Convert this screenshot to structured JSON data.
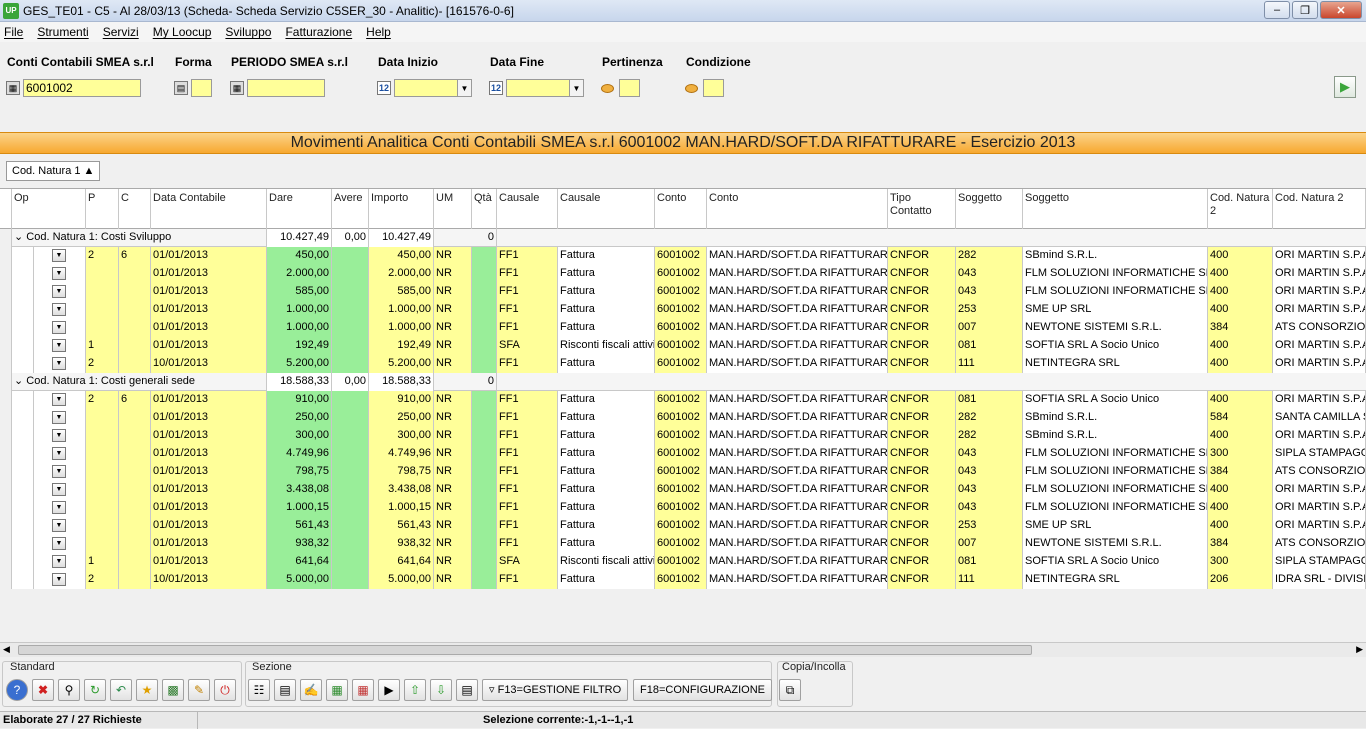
{
  "window": {
    "title": "GES_TE01 - C5 - Al 28/03/13 (Scheda- Scheda Servizio C5SER_30 - Analitic)- [161576-0-6]",
    "app_badge": "UP"
  },
  "menu": [
    "File",
    "Strumenti",
    "Servizi",
    "My Loocup",
    "Sviluppo",
    "Fatturazione",
    "Help"
  ],
  "filters": {
    "conti_label": "Conti Contabili SMEA s.r.l",
    "conti_value": "6001002",
    "forma_label": "Forma",
    "forma_value": "",
    "periodo_label": "PERIODO SMEA s.r.l",
    "periodo_value": "",
    "data_inizio_label": "Data Inizio",
    "data_inizio_value": "",
    "data_fine_label": "Data Fine",
    "data_fine_value": "",
    "pertinenza_label": "Pertinenza",
    "pertinenza_value": "",
    "condizione_label": "Condizione",
    "condizione_value": ""
  },
  "banner": "Movimenti Analitica Conti Contabili SMEA s.r.l 6001002 MAN.HARD/SOFT.DA RIFATTURARE - Esercizio 2013",
  "groupby": "Cod. Natura 1",
  "columns": [
    "Op",
    "P",
    "C",
    "Data Contabile",
    "Dare",
    "Avere",
    "Importo",
    "UM",
    "Qtà",
    "Causale",
    "Causale",
    "Conto",
    "Conto",
    "Tipo Contatto",
    "Soggetto",
    "Soggetto",
    "Cod. Natura 2",
    "Cod. Natura 2"
  ],
  "groups": [
    {
      "label": "Cod. Natura 1: Costi Sviluppo",
      "dare": "10.427,49",
      "avere": "0,00",
      "importo": "10.427,49",
      "qta": "0",
      "rows": [
        [
          "2",
          "6",
          "01/01/2013",
          "450,00",
          "450,00",
          "NR",
          "FF1",
          "Fattura",
          "6001002",
          "MAN.HARD/SOFT.DA RIFATTURARE",
          "CNFOR",
          "282",
          "SBmind S.R.L.",
          "400",
          "ORI MARTIN S.P.A."
        ],
        [
          "",
          "",
          "01/01/2013",
          "2.000,00",
          "2.000,00",
          "NR",
          "FF1",
          "Fattura",
          "6001002",
          "MAN.HARD/SOFT.DA RIFATTURARE",
          "CNFOR",
          "043",
          "FLM SOLUZIONI INFORMATICHE SRL",
          "400",
          "ORI MARTIN S.P.A."
        ],
        [
          "",
          "",
          "01/01/2013",
          "585,00",
          "585,00",
          "NR",
          "FF1",
          "Fattura",
          "6001002",
          "MAN.HARD/SOFT.DA RIFATTURARE",
          "CNFOR",
          "043",
          "FLM SOLUZIONI INFORMATICHE SRL",
          "400",
          "ORI MARTIN S.P.A."
        ],
        [
          "",
          "",
          "01/01/2013",
          "1.000,00",
          "1.000,00",
          "NR",
          "FF1",
          "Fattura",
          "6001002",
          "MAN.HARD/SOFT.DA RIFATTURARE",
          "CNFOR",
          "253",
          "SME UP SRL",
          "400",
          "ORI MARTIN S.P.A."
        ],
        [
          "",
          "",
          "01/01/2013",
          "1.000,00",
          "1.000,00",
          "NR",
          "FF1",
          "Fattura",
          "6001002",
          "MAN.HARD/SOFT.DA RIFATTURARE",
          "CNFOR",
          "007",
          "NEWTONE SISTEMI S.R.L.",
          "384",
          "ATS CONSORZIO V"
        ],
        [
          "1",
          "",
          "01/01/2013",
          "192,49",
          "192,49",
          "NR",
          "SFA",
          "Risconti fiscali attivi",
          "6001002",
          "MAN.HARD/SOFT.DA RIFATTURARE",
          "CNFOR",
          "081",
          "SOFTIA SRL A Socio Unico",
          "400",
          "ORI MARTIN S.P.A."
        ],
        [
          "2",
          "",
          "10/01/2013",
          "5.200,00",
          "5.200,00",
          "NR",
          "FF1",
          "Fattura",
          "6001002",
          "MAN.HARD/SOFT.DA RIFATTURARE",
          "CNFOR",
          "111",
          "NETINTEGRA SRL",
          "400",
          "ORI MARTIN S.P.A."
        ]
      ]
    },
    {
      "label": "Cod. Natura 1: Costi generali sede",
      "dare": "18.588,33",
      "avere": "0,00",
      "importo": "18.588,33",
      "qta": "0",
      "rows": [
        [
          "2",
          "6",
          "01/01/2013",
          "910,00",
          "910,00",
          "NR",
          "FF1",
          "Fattura",
          "6001002",
          "MAN.HARD/SOFT.DA RIFATTURARE",
          "CNFOR",
          "081",
          "SOFTIA SRL A Socio Unico",
          "400",
          "ORI MARTIN S.P.A."
        ],
        [
          "",
          "",
          "01/01/2013",
          "250,00",
          "250,00",
          "NR",
          "FF1",
          "Fattura",
          "6001002",
          "MAN.HARD/SOFT.DA RIFATTURARE",
          "CNFOR",
          "282",
          "SBmind S.R.L.",
          "584",
          "SANTA CAMILLA S"
        ],
        [
          "",
          "",
          "01/01/2013",
          "300,00",
          "300,00",
          "NR",
          "FF1",
          "Fattura",
          "6001002",
          "MAN.HARD/SOFT.DA RIFATTURARE",
          "CNFOR",
          "282",
          "SBmind S.R.L.",
          "400",
          "ORI MARTIN S.P.A."
        ],
        [
          "",
          "",
          "01/01/2013",
          "4.749,96",
          "4.749,96",
          "NR",
          "FF1",
          "Fattura",
          "6001002",
          "MAN.HARD/SOFT.DA RIFATTURARE",
          "CNFOR",
          "043",
          "FLM SOLUZIONI INFORMATICHE SRL",
          "300",
          "SIPLA STAMPAGGI"
        ],
        [
          "",
          "",
          "01/01/2013",
          "798,75",
          "798,75",
          "NR",
          "FF1",
          "Fattura",
          "6001002",
          "MAN.HARD/SOFT.DA RIFATTURARE",
          "CNFOR",
          "043",
          "FLM SOLUZIONI INFORMATICHE SRL",
          "384",
          "ATS CONSORZIO V"
        ],
        [
          "",
          "",
          "01/01/2013",
          "3.438,08",
          "3.438,08",
          "NR",
          "FF1",
          "Fattura",
          "6001002",
          "MAN.HARD/SOFT.DA RIFATTURARE",
          "CNFOR",
          "043",
          "FLM SOLUZIONI INFORMATICHE SRL",
          "400",
          "ORI MARTIN S.P.A."
        ],
        [
          "",
          "",
          "01/01/2013",
          "1.000,15",
          "1.000,15",
          "NR",
          "FF1",
          "Fattura",
          "6001002",
          "MAN.HARD/SOFT.DA RIFATTURARE",
          "CNFOR",
          "043",
          "FLM SOLUZIONI INFORMATICHE SRL",
          "400",
          "ORI MARTIN S.P.A."
        ],
        [
          "",
          "",
          "01/01/2013",
          "561,43",
          "561,43",
          "NR",
          "FF1",
          "Fattura",
          "6001002",
          "MAN.HARD/SOFT.DA RIFATTURARE",
          "CNFOR",
          "253",
          "SME UP SRL",
          "400",
          "ORI MARTIN S.P.A."
        ],
        [
          "",
          "",
          "01/01/2013",
          "938,32",
          "938,32",
          "NR",
          "FF1",
          "Fattura",
          "6001002",
          "MAN.HARD/SOFT.DA RIFATTURARE",
          "CNFOR",
          "007",
          "NEWTONE SISTEMI S.R.L.",
          "384",
          "ATS CONSORZIO V"
        ],
        [
          "1",
          "",
          "01/01/2013",
          "641,64",
          "641,64",
          "NR",
          "SFA",
          "Risconti fiscali attivi",
          "6001002",
          "MAN.HARD/SOFT.DA RIFATTURARE",
          "CNFOR",
          "081",
          "SOFTIA SRL A Socio Unico",
          "300",
          "SIPLA STAMPAGGI"
        ],
        [
          "2",
          "",
          "10/01/2013",
          "5.000,00",
          "5.000,00",
          "NR",
          "FF1",
          "Fattura",
          "6001002",
          "MAN.HARD/SOFT.DA RIFATTURARE",
          "CNFOR",
          "111",
          "NETINTEGRA SRL",
          "206",
          "IDRA SRL - DIVISI"
        ]
      ]
    }
  ],
  "toolbar": {
    "standard_label": "Standard",
    "sezione_label": "Sezione",
    "copia_label": "Copia/Incolla",
    "f13": "F13=GESTIONE FILTRO",
    "f18": "F18=CONFIGURAZIONE"
  },
  "status": {
    "left": "Elaborate 27 / 27 Richieste",
    "middle": "Selezione corrente:-1,-1--1,-1"
  }
}
